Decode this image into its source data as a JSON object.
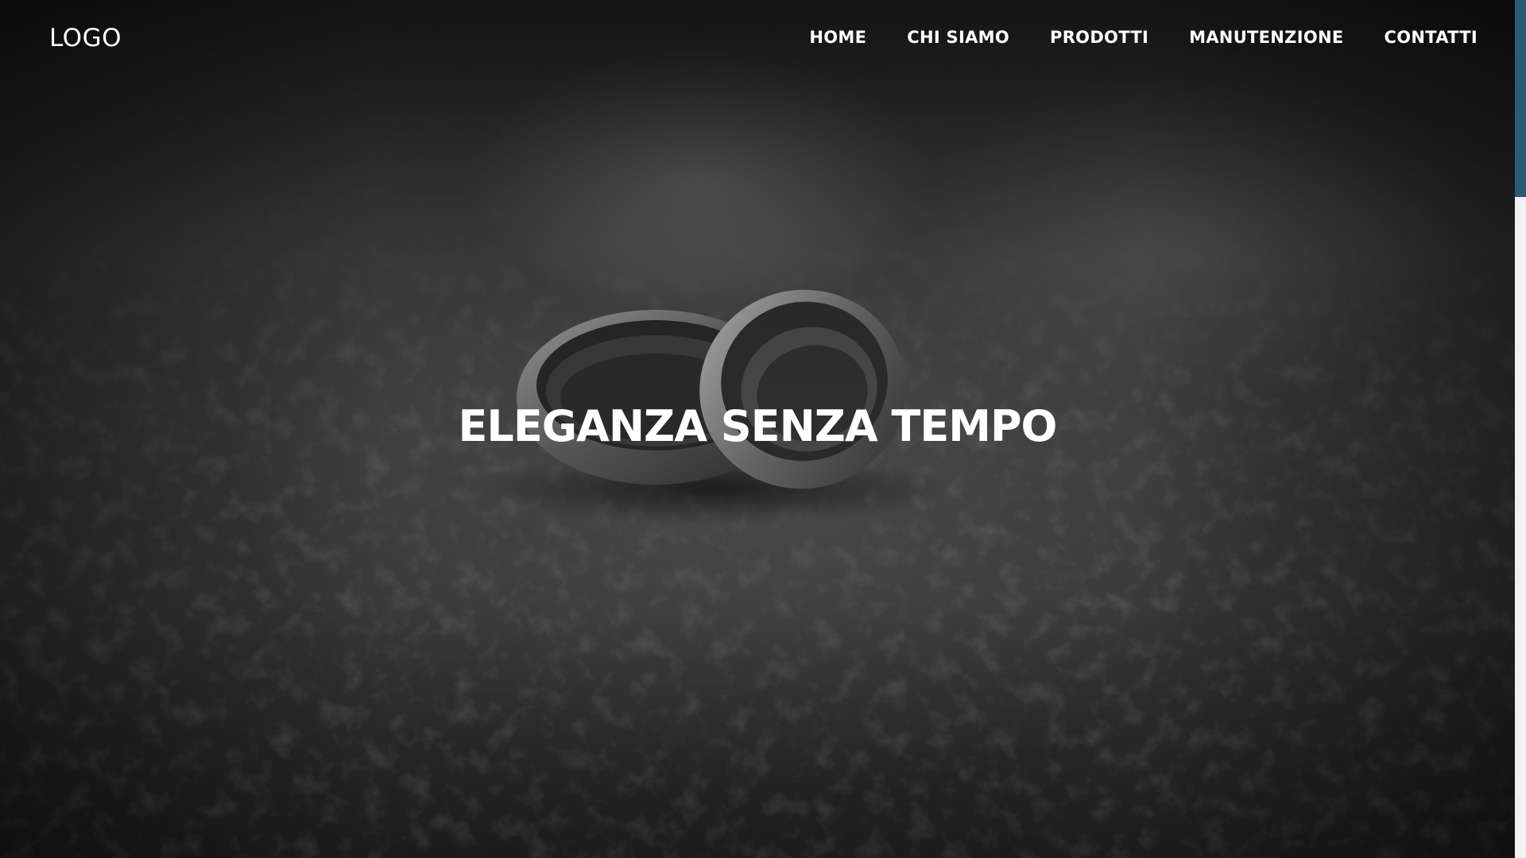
{
  "header": {
    "logo": "LOGO",
    "nav": [
      {
        "label": "HOME"
      },
      {
        "label": "CHI SIAMO"
      },
      {
        "label": "PRODOTTI"
      },
      {
        "label": "MANUTENZIONE"
      },
      {
        "label": "CONTATTI"
      }
    ]
  },
  "hero": {
    "title": "ELEGANZA SENZA TEMPO",
    "image": "wedding-rings-on-dark-leather"
  },
  "scrollbar": {
    "thumb_color": "#2b5b73",
    "position": 0
  }
}
